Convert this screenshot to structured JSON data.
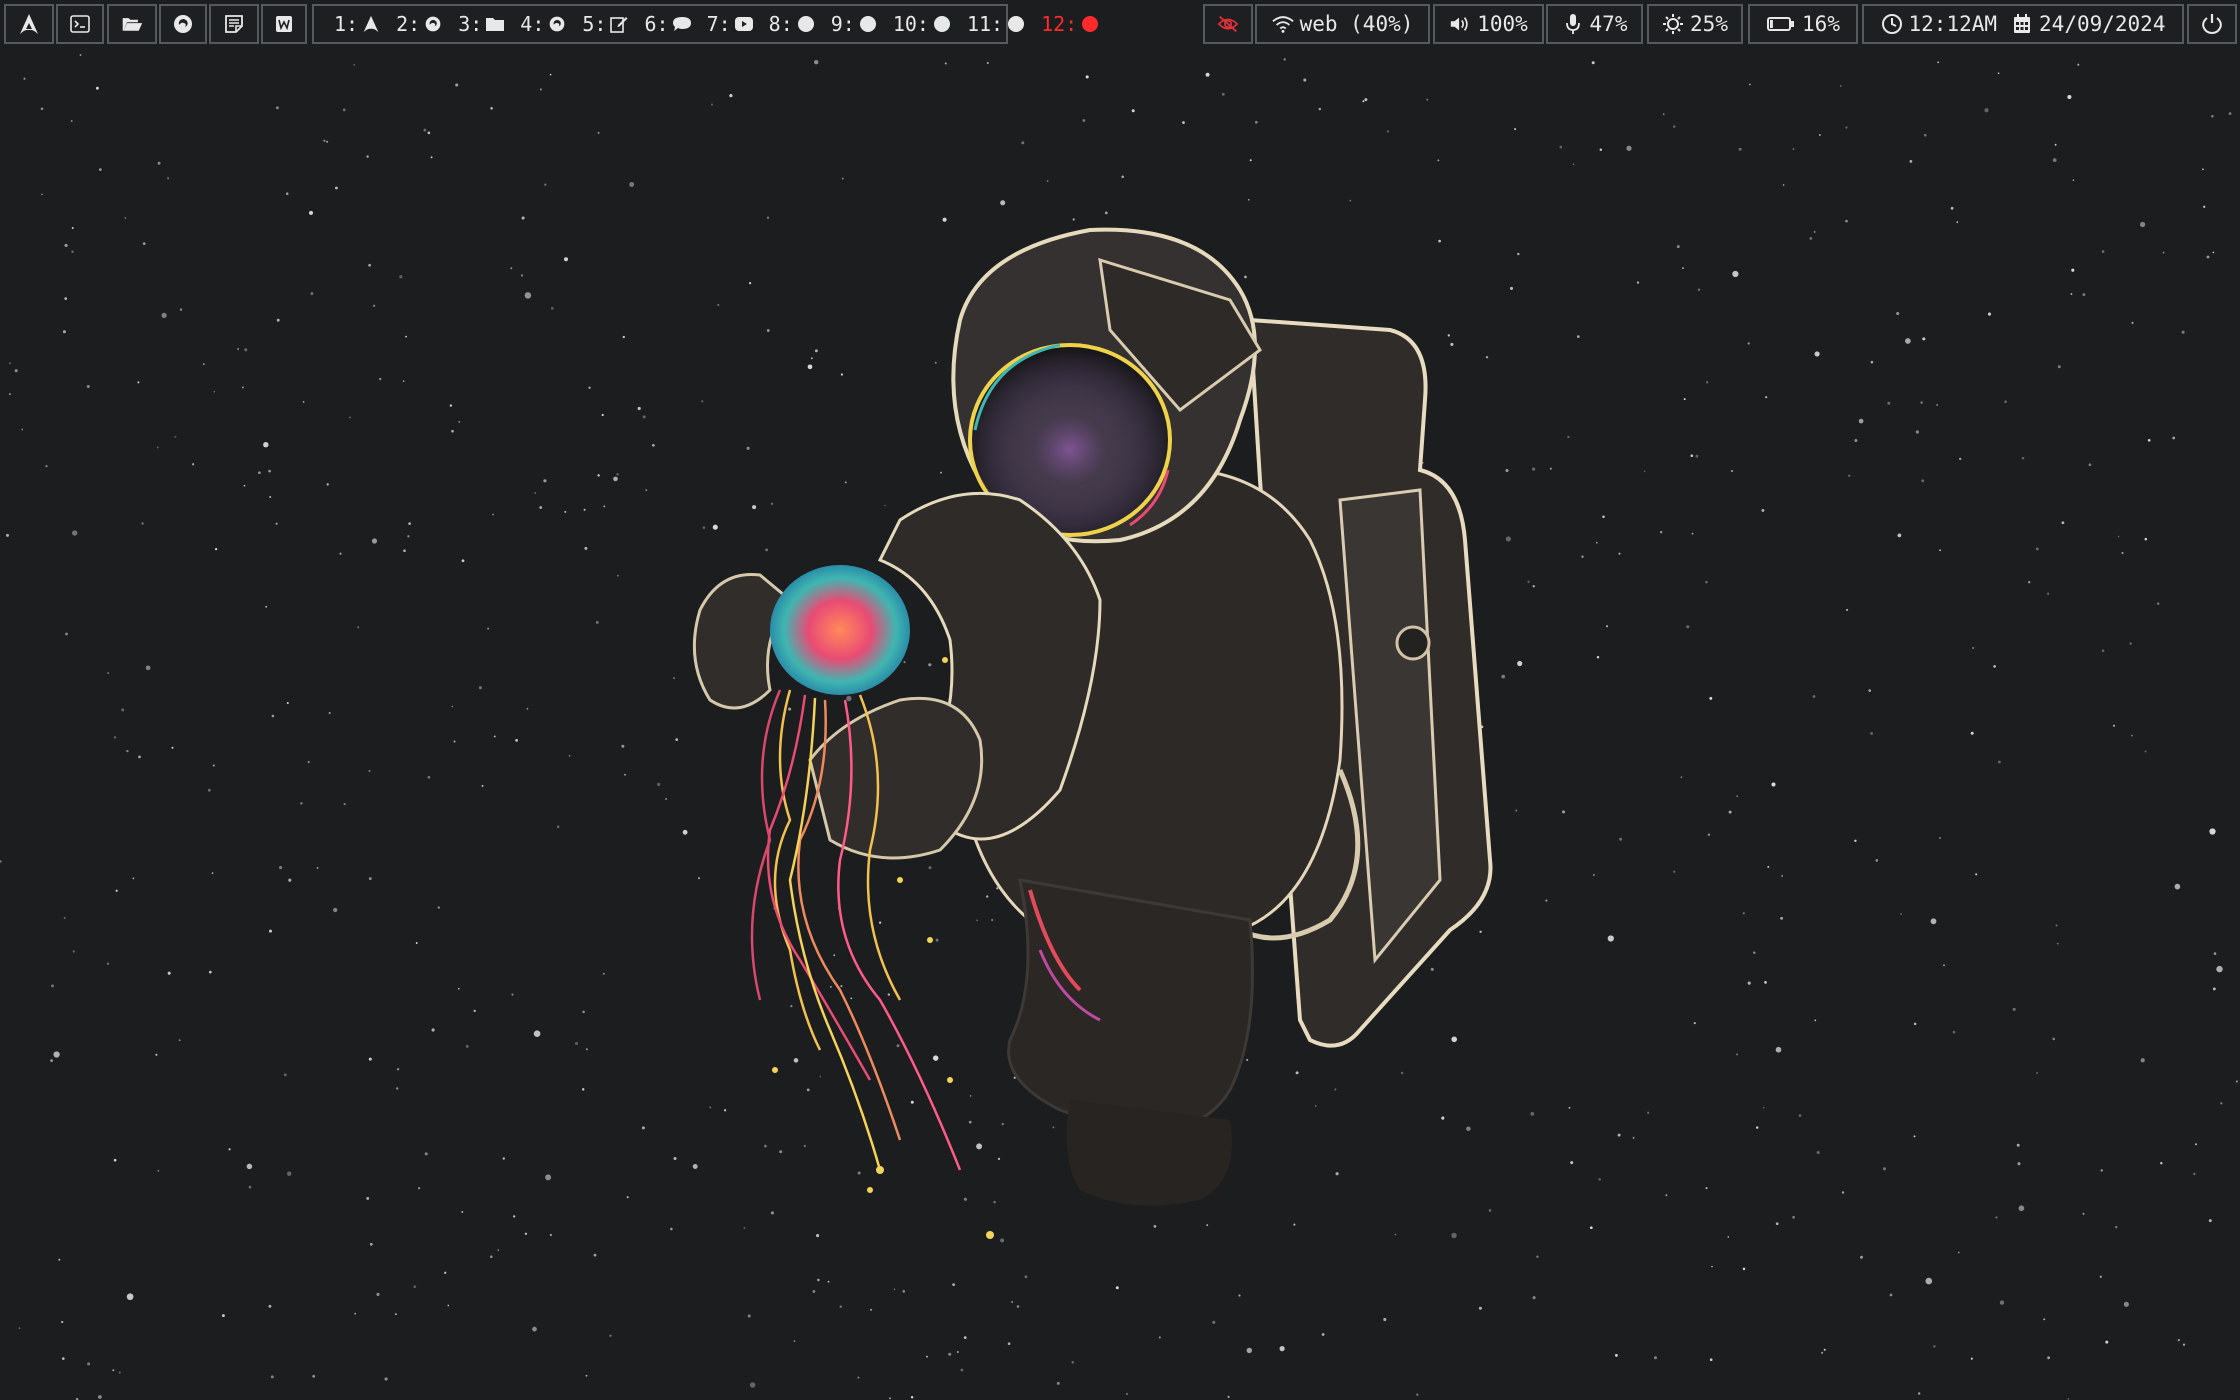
{
  "launchers": [
    {
      "name": "arch-logo-icon"
    },
    {
      "name": "terminal-icon"
    },
    {
      "name": "folder-open-icon"
    },
    {
      "name": "firefox-icon"
    },
    {
      "name": "notes-icon"
    },
    {
      "name": "writer-icon"
    }
  ],
  "workspaces": [
    {
      "label": "1:",
      "icon": "arch-logo-icon"
    },
    {
      "label": "2:",
      "icon": "firefox-icon"
    },
    {
      "label": "3:",
      "icon": "folder-icon"
    },
    {
      "label": "4:",
      "icon": "firefox-icon"
    },
    {
      "label": "5:",
      "icon": "edit-icon"
    },
    {
      "label": "6:",
      "icon": "chat-icon"
    },
    {
      "label": "7:",
      "icon": "youtube-icon"
    },
    {
      "label": "8:",
      "icon": "circle-icon"
    },
    {
      "label": "9:",
      "icon": "circle-icon"
    },
    {
      "label": "10:",
      "icon": "circle-icon"
    },
    {
      "label": "11:",
      "icon": "circle-icon"
    },
    {
      "label": "12:",
      "icon": "circle-icon",
      "active": true
    }
  ],
  "status": {
    "privacy_icon": "eye-slash-icon",
    "wifi": "web (40%)",
    "volume": "100%",
    "mic": "47%",
    "brightness": "25%",
    "battery": "16%",
    "time": "12:12AM",
    "date": "24/09/2024",
    "power_icon": "power-icon"
  },
  "colors": {
    "bar_bg": "#1d1f21",
    "border": "#555a5f",
    "active_workspace": "#ff2a2a",
    "wallpaper_bg": "#1b1d1e"
  }
}
